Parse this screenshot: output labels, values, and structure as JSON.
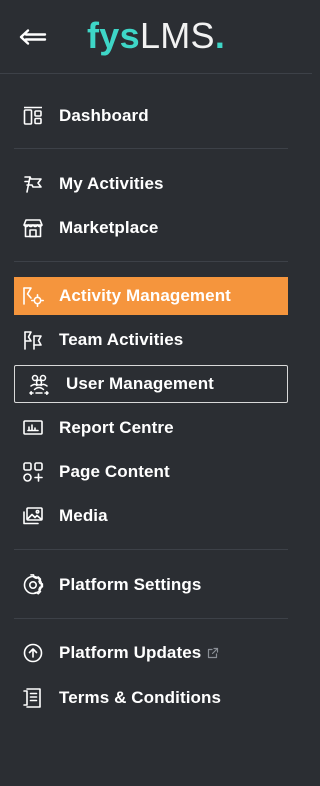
{
  "brand": {
    "logo_part1": "fys",
    "logo_part2": "LMS",
    "logo_dot": ".",
    "accent_color": "#3ed6c7"
  },
  "header": {
    "collapse_icon": "collapse-arrow-icon"
  },
  "nav": {
    "active_color": "#f5953d",
    "items": [
      {
        "label": "Dashboard",
        "icon": "dashboard-icon"
      },
      {
        "label": "My Activities",
        "icon": "flag-icon"
      },
      {
        "label": "Marketplace",
        "icon": "store-icon"
      },
      {
        "label": "Activity Management",
        "icon": "activity-shapes-icon",
        "state": "active"
      },
      {
        "label": "Team Activities",
        "icon": "team-flags-icon"
      },
      {
        "label": "User Management",
        "icon": "users-icon",
        "state": "focused"
      },
      {
        "label": "Report Centre",
        "icon": "report-icon"
      },
      {
        "label": "Page Content",
        "icon": "page-content-icon"
      },
      {
        "label": "Media",
        "icon": "media-icon"
      },
      {
        "label": "Platform Settings",
        "icon": "gear-icon"
      },
      {
        "label": "Platform Updates",
        "icon": "update-gear-icon",
        "external": true
      },
      {
        "label": "Terms & Conditions",
        "icon": "document-icon"
      }
    ]
  }
}
